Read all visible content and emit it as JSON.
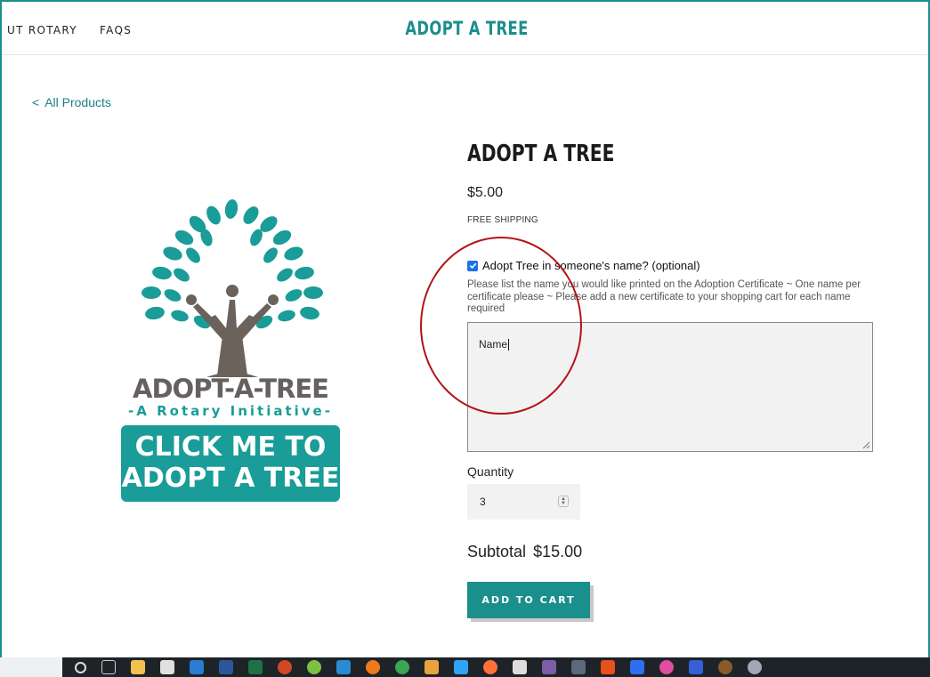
{
  "nav": {
    "items": [
      "UT ROTARY",
      "FAQS"
    ],
    "site_title": "ADOPT A TREE"
  },
  "back_link": {
    "chevron": "<",
    "label": "All Products"
  },
  "product_image": {
    "brand_title": "ADOPT-A-TREE",
    "brand_subtitle": "-A Rotary Initiative-",
    "cta_line1": "CLICK ME TO",
    "cta_line2": "ADOPT A TREE"
  },
  "product": {
    "title": "ADOPT A TREE",
    "price": "$5.00",
    "shipping": "FREE SHIPPING",
    "option_label": "Adopt Tree in someone's name? (optional)",
    "option_checked": true,
    "option_help": "Please list the name you would like printed on the Adoption Certificate ~ One name per certificate please ~ Please add a new certificate to your shopping cart for each name required",
    "name_value": "Name",
    "quantity_label": "Quantity",
    "quantity_value": "3",
    "subtotal_label": "Subtotal",
    "subtotal_value": "$15.00",
    "add_to_cart": "ADD TO CART"
  },
  "colors": {
    "brand_teal": "#1a8f8c",
    "annotation_red": "#b3121a"
  },
  "taskbar": {
    "icons": [
      "cortana-icon",
      "task-view-icon",
      "file-explorer-icon",
      "acrobat-icon",
      "outlook-icon",
      "word-icon",
      "excel-icon",
      "powerpoint-icon",
      "app-icon",
      "onedrive-icon",
      "app-icon",
      "chrome-icon",
      "app-icon",
      "photoshop-icon",
      "firefox-icon",
      "acrobat-icon",
      "app-icon",
      "app-icon",
      "app-icon",
      "app-icon",
      "itunes-icon",
      "app-icon",
      "app-icon",
      "app-icon"
    ]
  }
}
